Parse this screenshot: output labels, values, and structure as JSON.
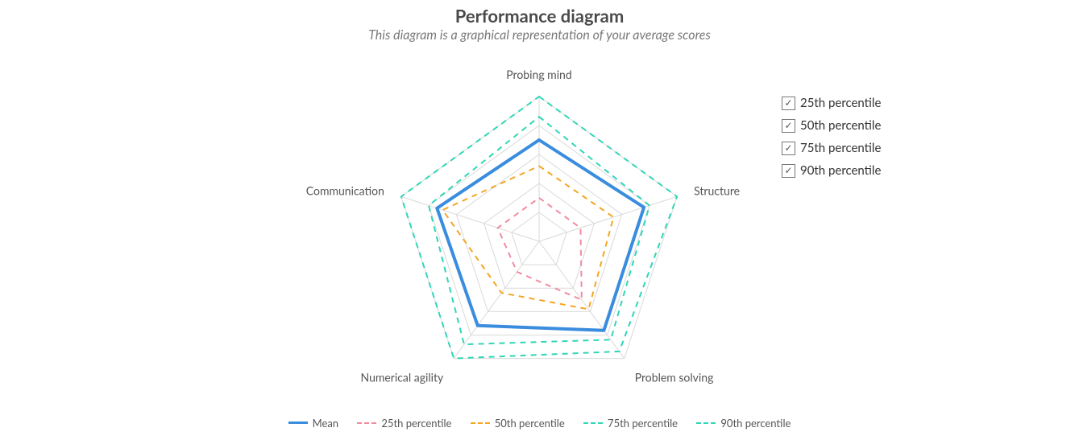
{
  "title": "Performance diagram",
  "subtitle": "This diagram is a graphical representation of your average scores",
  "chart_data": {
    "type": "radar",
    "categories": [
      "Probing mind",
      "Structure",
      "Problem solving",
      "Numerical agility",
      "Communication"
    ],
    "max": 5,
    "rings": [
      1,
      2,
      3,
      4,
      5
    ],
    "series": [
      {
        "name": "Mean",
        "color": "#3a8dde",
        "dashed": false,
        "width": 4,
        "values": [
          3.5,
          3.8,
          3.8,
          3.6,
          3.7
        ]
      },
      {
        "name": "25th percentile",
        "color": "#f08ca0",
        "dashed": true,
        "width": 2,
        "values": [
          1.5,
          1.5,
          2.5,
          1.3,
          1.5
        ]
      },
      {
        "name": "50th percentile",
        "color": "#f5a623",
        "dashed": true,
        "width": 2,
        "values": [
          2.6,
          2.7,
          2.9,
          2.2,
          3.5
        ]
      },
      {
        "name": "75th percentile",
        "color": "#2fd6b8",
        "dashed": true,
        "width": 2,
        "values": [
          4.3,
          4.0,
          4.2,
          4.4,
          4.0
        ]
      },
      {
        "name": "90th percentile",
        "color": "#2fd6b8",
        "dashed": true,
        "width": 2,
        "values": [
          5.0,
          5.0,
          4.7,
          5.0,
          5.0
        ]
      }
    ]
  },
  "legend": {
    "items": [
      {
        "label": "Mean",
        "color": "#3a8dde",
        "dashed": false
      },
      {
        "label": "25th percentile",
        "color": "#f08ca0",
        "dashed": true
      },
      {
        "label": "50th percentile",
        "color": "#f5a623",
        "dashed": true
      },
      {
        "label": "75th percentile",
        "color": "#2fd6b8",
        "dashed": true
      },
      {
        "label": "90th percentile",
        "color": "#2fd6b8",
        "dashed": true
      }
    ]
  },
  "toggles": {
    "items": [
      {
        "label": "25th percentile",
        "checked": true
      },
      {
        "label": "50th percentile",
        "checked": true
      },
      {
        "label": "75th percentile",
        "checked": true
      },
      {
        "label": "90th percentile",
        "checked": true
      }
    ]
  }
}
